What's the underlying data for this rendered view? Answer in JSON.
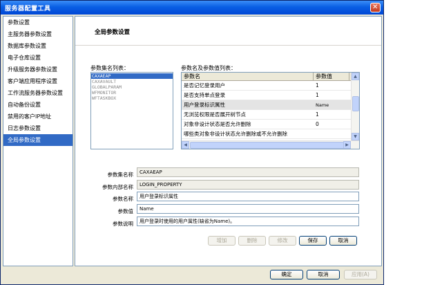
{
  "window": {
    "title": "服务器配置工具",
    "close_glyph": "✕"
  },
  "sidebar": {
    "items": [
      {
        "label": "参数设置"
      },
      {
        "label": "主服务器参数设置"
      },
      {
        "label": "数据库参数设置"
      },
      {
        "label": "电子仓库设置"
      },
      {
        "label": "升级服务器参数设置"
      },
      {
        "label": "客户端应用程序设置"
      },
      {
        "label": "工作流服务器参数设置"
      },
      {
        "label": "自动备份设置"
      },
      {
        "label": "禁用的客户IP地址"
      },
      {
        "label": "日志参数设置"
      },
      {
        "label": "全局参数设置"
      }
    ],
    "selected_index": 10
  },
  "main": {
    "title": "全局参数设置",
    "set_list_label": "参数集名列表：",
    "set_list": [
      "CAXAEAP",
      "CAXAVAULT",
      "GLOBALPARAM",
      "WFMONITOR",
      "WFTASKBOX"
    ],
    "param_list_label": "参数名及参数值列表：",
    "grid": {
      "headers": [
        "参数名",
        "参数值"
      ],
      "rows": [
        {
          "name": "是否记忆登录用户",
          "value": "1"
        },
        {
          "name": "是否支持单点登录",
          "value": "1"
        },
        {
          "name": "用户登录标识属性",
          "value": "Name"
        },
        {
          "name": "无浏览权限是否展开树节点",
          "value": "1"
        },
        {
          "name": "对象非设计状态是否允许删除",
          "value": "0"
        },
        {
          "name": "哪些类对象非设计状态允许删除或不允许删除",
          "value": ""
        }
      ],
      "selected_row": 2
    },
    "form": {
      "set_name_label": "参数集名称",
      "set_name_value": "CAXAEAP",
      "internal_name_label": "参数内部名称",
      "internal_name_value": "LOGIN_PROPERTY",
      "param_name_label": "参数名称",
      "param_name_value": "用户登录标识属性",
      "param_value_label": "参数值",
      "param_value_value": "Name",
      "param_desc_label": "参数说明",
      "param_desc_value": "用户登录时使用的用户属性(缺省为Name)。"
    },
    "actions": {
      "add": "增加",
      "delete": "删除",
      "modify": "修改",
      "save": "保存",
      "cancel": "取消"
    }
  },
  "footer": {
    "ok": "确定",
    "cancel": "取消",
    "apply": "应用(A)"
  }
}
